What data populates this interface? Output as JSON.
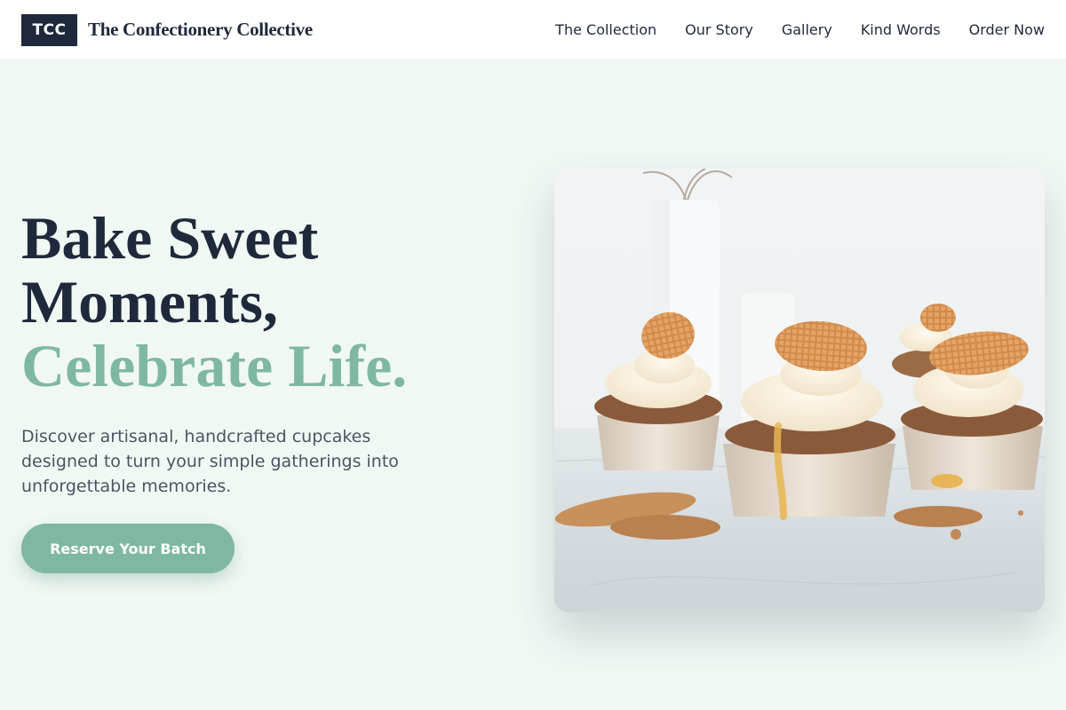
{
  "header": {
    "logo_text": "TCC",
    "brand_name": "The Confectionery Collective",
    "nav": [
      "The Collection",
      "Our Story",
      "Gallery",
      "Kind Words",
      "Order Now"
    ]
  },
  "hero": {
    "headline_line1": "Bake Sweet",
    "headline_line2": "Moments,",
    "headline_accent": "Celebrate Life.",
    "subtext": "Discover artisanal, handcrafted cupcakes designed to turn your simple gatherings into unforgettable memories.",
    "cta_label": "Reserve Your Batch",
    "image_alt": "Cupcakes topped with cream and waffle cookies on a marble counter"
  },
  "colors": {
    "primary_dark": "#1e293b",
    "accent_green": "#7fb8a0",
    "page_background": "#f1f8f4"
  }
}
